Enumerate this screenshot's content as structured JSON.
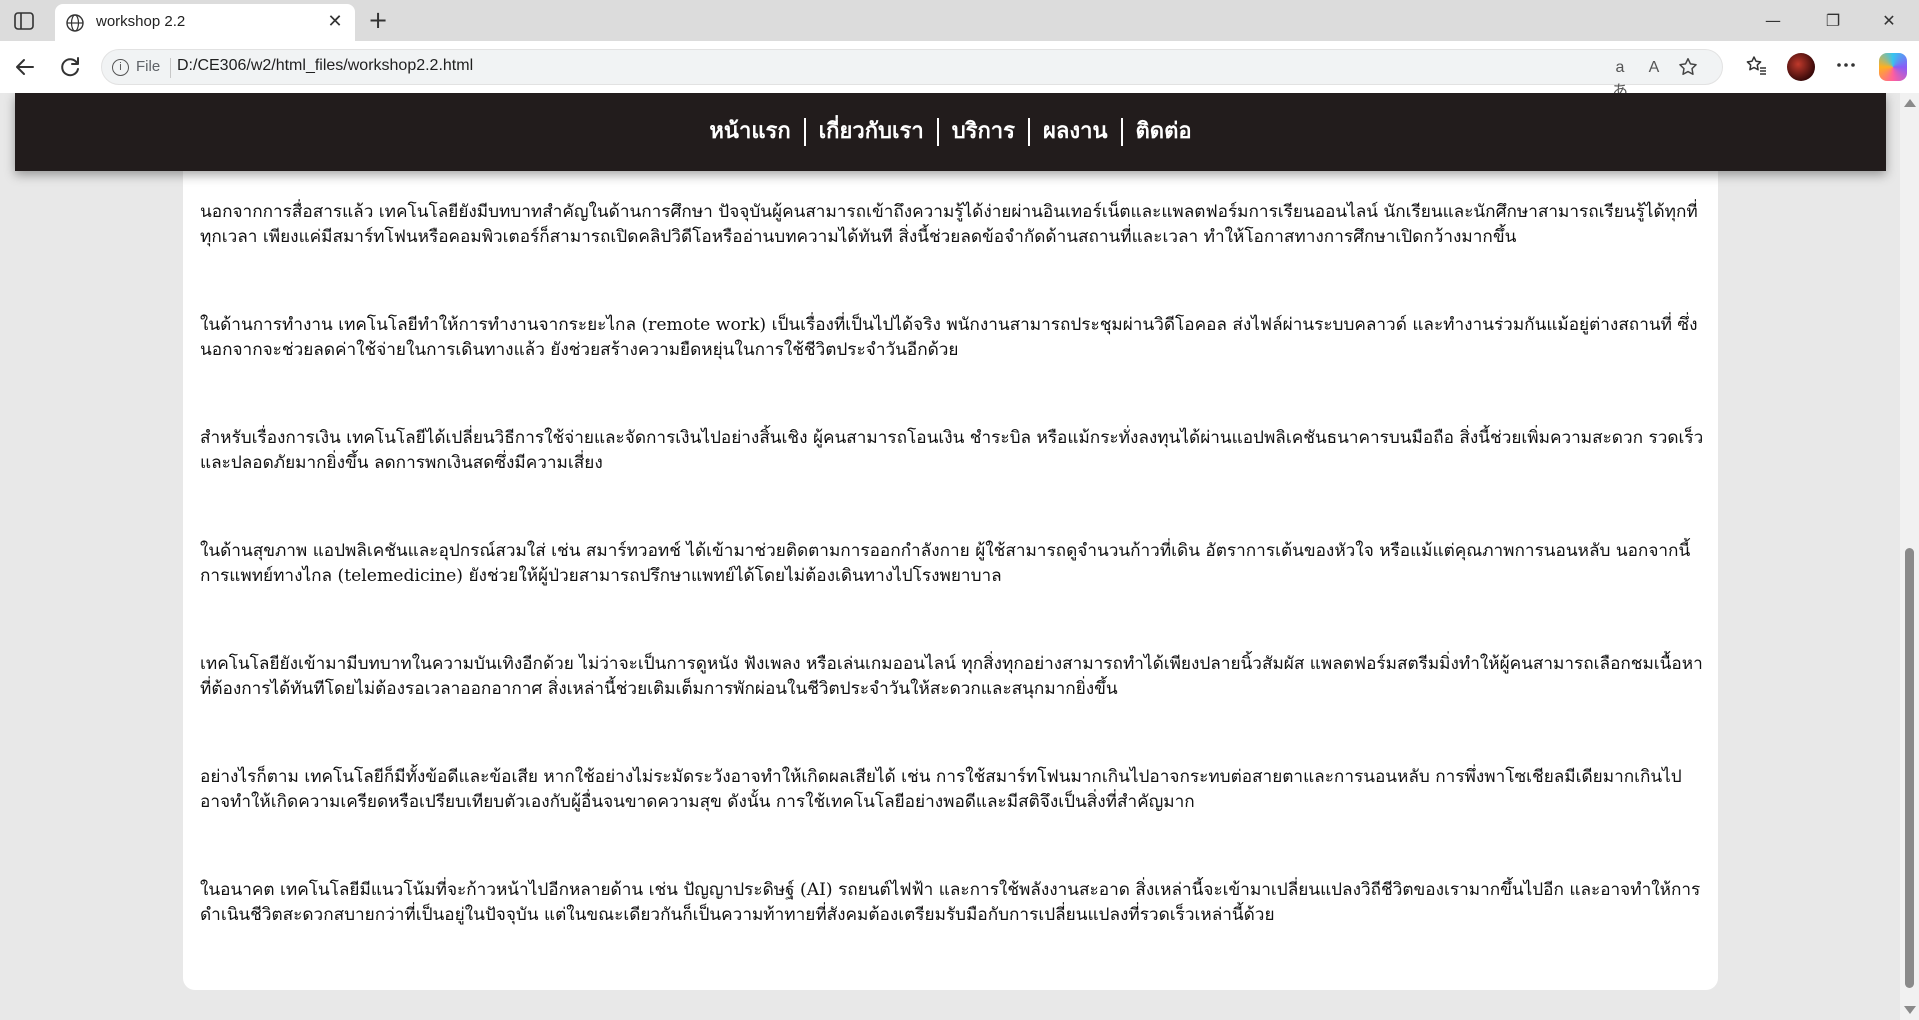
{
  "browser": {
    "tab_title": "workshop 2.2",
    "file_label": "File",
    "url": "D:/CE306/w2/html_files/workshop2.2.html",
    "read_aloud_label": "aあ",
    "text_size_label": "A",
    "window_controls": {
      "minimize": "—",
      "maximize": "❐",
      "close": "✕"
    },
    "new_tab": "+",
    "tab_close": "✕"
  },
  "nav": {
    "items": [
      {
        "label": "หน้าแรก"
      },
      {
        "label": "เกี่ยวกับเรา"
      },
      {
        "label": "บริการ"
      },
      {
        "label": "ผลงาน"
      },
      {
        "label": "ติดต่อ"
      }
    ]
  },
  "article": {
    "paragraphs": [
      "นอกจากการสื่อสารแล้ว เทคโนโลยียังมีบทบาทสำคัญในด้านการศึกษา ปัจจุบันผู้คนสามารถเข้าถึงความรู้ได้ง่ายผ่านอินเทอร์เน็ตและแพลตฟอร์มการเรียนออนไลน์ นักเรียนและนักศึกษาสามารถเรียนรู้ได้ทุกที่ทุกเวลา เพียงแค่มีสมาร์ทโฟนหรือคอมพิวเตอร์ก็สามารถเปิดคลิปวิดีโอหรืออ่านบทความได้ทันที สิ่งนี้ช่วยลดข้อจำกัดด้านสถานที่และเวลา ทำให้โอกาสทางการศึกษาเปิดกว้างมากขึ้น",
      "ในด้านการทำงาน เทคโนโลยีทำให้การทำงานจากระยะไกล (remote work) เป็นเรื่องที่เป็นไปได้จริง พนักงานสามารถประชุมผ่านวิดีโอคอล ส่งไฟล์ผ่านระบบคลาวด์ และทำงานร่วมกันแม้อยู่ต่างสถานที่ ซึ่งนอกจากจะช่วยลดค่าใช้จ่ายในการเดินทางแล้ว ยังช่วยสร้างความยืดหยุ่นในการใช้ชีวิตประจำวันอีกด้วย",
      "สำหรับเรื่องการเงิน เทคโนโลยีได้เปลี่ยนวิธีการใช้จ่ายและจัดการเงินไปอย่างสิ้นเชิง ผู้คนสามารถโอนเงิน ชำระบิล หรือแม้กระทั่งลงทุนได้ผ่านแอปพลิเคชันธนาคารบนมือถือ สิ่งนี้ช่วยเพิ่มความสะดวก รวดเร็ว และปลอดภัยมากยิ่งขึ้น ลดการพกเงินสดซึ่งมีความเสี่ยง",
      "ในด้านสุขภาพ แอปพลิเคชันและอุปกรณ์สวมใส่ เช่น สมาร์ทวอทช์ ได้เข้ามาช่วยติดตามการออกกำลังกาย ผู้ใช้สามารถดูจำนวนก้าวที่เดิน อัตราการเต้นของหัวใจ หรือแม้แต่คุณภาพการนอนหลับ นอกจากนี้ การแพทย์ทางไกล (telemedicine) ยังช่วยให้ผู้ป่วยสามารถปรึกษาแพทย์ได้โดยไม่ต้องเดินทางไปโรงพยาบาล",
      "เทคโนโลยียังเข้ามามีบทบาทในความบันเทิงอีกด้วย ไม่ว่าจะเป็นการดูหนัง ฟังเพลง หรือเล่นเกมออนไลน์ ทุกสิ่งทุกอย่างสามารถทำได้เพียงปลายนิ้วสัมผัส แพลตฟอร์มสตรีมมิ่งทำให้ผู้คนสามารถเลือกชมเนื้อหาที่ต้องการได้ทันทีโดยไม่ต้องรอเวลาออกอากาศ สิ่งเหล่านี้ช่วยเติมเต็มการพักผ่อนในชีวิตประจำวันให้สะดวกและสนุกมากยิ่งขึ้น",
      "อย่างไรก็ตาม เทคโนโลยีก็มีทั้งข้อดีและข้อเสีย หากใช้อย่างไม่ระมัดระวังอาจทำให้เกิดผลเสียได้ เช่น การใช้สมาร์ทโฟนมากเกินไปอาจกระทบต่อสายตาและการนอนหลับ การพึ่งพาโซเชียลมีเดียมากเกินไปอาจทำให้เกิดความเครียดหรือเปรียบเทียบตัวเองกับผู้อื่นจนขาดความสุข ดังนั้น การใช้เทคโนโลยีอย่างพอดีและมีสติจึงเป็นสิ่งที่สำคัญมาก",
      "ในอนาคต เทคโนโลยีมีแนวโน้มที่จะก้าวหน้าไปอีกหลายด้าน เช่น ปัญญาประดิษฐ์ (AI) รถยนต์ไฟฟ้า และการใช้พลังงานสะอาด สิ่งเหล่านี้จะเข้ามาเปลี่ยนแปลงวิถีชีวิตของเรามากขึ้นไปอีก และอาจทำให้การดำเนินชีวิตสะดวกสบายกว่าที่เป็นอยู่ในปัจจุบัน แต่ในขณะเดียวกันก็เป็นความท้าทายที่สังคมต้องเตรียมรับมือกับการเปลี่ยนแปลงที่รวดเร็วเหล่านี้ด้วย"
    ]
  }
}
